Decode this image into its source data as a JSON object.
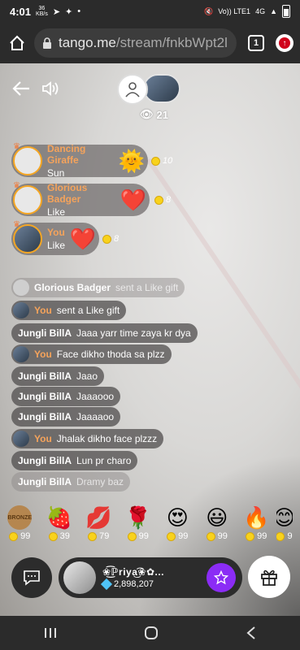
{
  "status_bar": {
    "time": "4:01",
    "net_speed_value": "36",
    "net_speed_unit": "KB/s",
    "network_label": "Vo)) LTE1",
    "signal_label": "4G"
  },
  "browser": {
    "url_host": "tango.me",
    "url_path": "/stream/fnkbWpt2l",
    "tab_count": "1"
  },
  "stream": {
    "viewer_count": "21",
    "gift_events": [
      {
        "user": "Dancing Giraffe",
        "action": "Sun",
        "icon": "sun-icon",
        "glyph": "🌞",
        "coins": "10"
      },
      {
        "user": "Glorious Badger",
        "action": "Like",
        "icon": "heart-icon",
        "glyph": "❤️",
        "coins": "8"
      },
      {
        "user": "You",
        "action": "Like",
        "icon": "heart-icon",
        "glyph": "❤️",
        "coins": "8"
      }
    ],
    "chat": [
      {
        "user": "Glorious Badger",
        "text": "sent a Like gift",
        "faded": true
      },
      {
        "user": "You",
        "text": "sent a Like gift"
      },
      {
        "user": "Jungli BillA",
        "text": "Jaaa yarr time zaya kr dya"
      },
      {
        "user": "You",
        "text": "Face dikho thoda sa plzz"
      },
      {
        "user": "Jungli BillA",
        "text": "Jaao"
      },
      {
        "user": "Jungli BillA",
        "text": "Jaaaooo"
      },
      {
        "user": "Jungli BillA",
        "text": "Jaaaaoo"
      },
      {
        "user": "You",
        "text": "Jhalak dikho face plzzz"
      },
      {
        "user": "Jungli BillA",
        "text": "Lun pr charo"
      },
      {
        "user": "Jungli BillA",
        "text": "Dramy baz",
        "faded": true
      }
    ]
  },
  "gift_strip": [
    {
      "name": "BRONZE",
      "price": "99"
    },
    {
      "name": "strawberry",
      "glyph": "🍓",
      "price": "39"
    },
    {
      "name": "lips",
      "glyph": "💋",
      "price": "79"
    },
    {
      "name": "rose",
      "glyph": "🌹",
      "price": "99"
    },
    {
      "name": "heart-eyes",
      "glyph": "😍",
      "price": "99"
    },
    {
      "name": "good-morning",
      "glyph": "😃",
      "price": "99"
    },
    {
      "name": "fire",
      "glyph": "🔥",
      "price": "99"
    },
    {
      "name": "partial",
      "glyph": "😊",
      "price": "9"
    }
  ],
  "host": {
    "name": "❀͜͡ℙriya͜͡❀✿...",
    "diamonds": "2,898,207"
  },
  "colors": {
    "you_name": "#f5a35b",
    "follow_button": "#8b2cf5",
    "crown": "#f07a3a"
  }
}
